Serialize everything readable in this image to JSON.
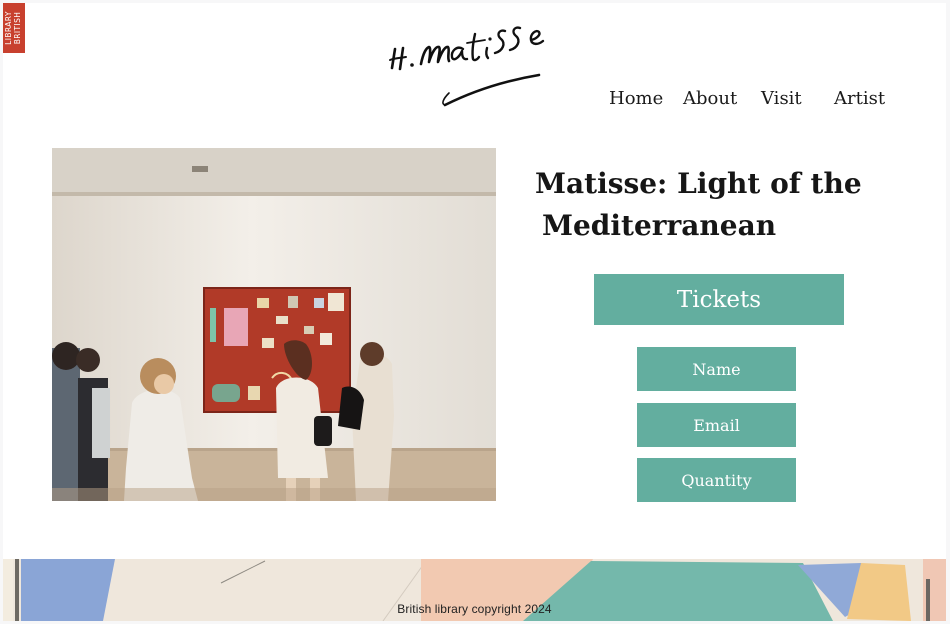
{
  "brand": {
    "badge_lines": [
      "LIBRARY",
      "BRITISH"
    ],
    "signature_text": "H. Matisse"
  },
  "nav": {
    "items": [
      {
        "label": "Home"
      },
      {
        "label": "About"
      },
      {
        "label": "Visit"
      },
      {
        "label": "Artist"
      }
    ]
  },
  "hero": {
    "title_line1": "Matisse: Light of the",
    "title_line2": "Mediterranean"
  },
  "tickets": {
    "button_label": "Tickets",
    "fields": {
      "name": "Name",
      "email": "Email",
      "quantity": "Quantity"
    }
  },
  "footer": {
    "copyright": "British library copyright 2024"
  },
  "colors": {
    "accent": "#63ae9f",
    "badge": "#c8402e",
    "text": "#161616"
  }
}
